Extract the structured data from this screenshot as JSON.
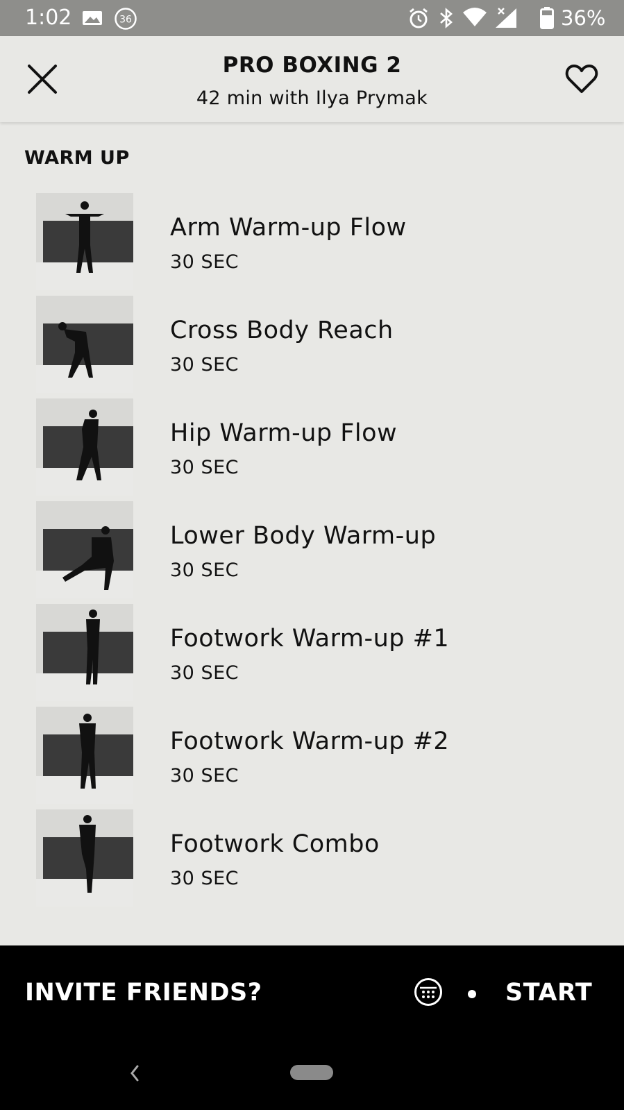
{
  "status_bar": {
    "time": "1:02",
    "notification_badge": "36",
    "battery": "36%",
    "icons": [
      "image-icon",
      "notification-count-icon",
      "alarm-icon",
      "bluetooth-icon",
      "wifi-icon",
      "signal-icon",
      "battery-icon"
    ]
  },
  "header": {
    "title": "PRO BOXING 2",
    "subtitle": "42 min with Ilya Prymak",
    "close_icon": "close-icon",
    "favorite_icon": "heart-icon"
  },
  "section": {
    "title": "WARM UP",
    "exercises": [
      {
        "name": "Arm Warm-up Flow",
        "duration": "30 SEC"
      },
      {
        "name": "Cross Body Reach",
        "duration": "30 SEC"
      },
      {
        "name": "Hip Warm-up Flow",
        "duration": "30 SEC"
      },
      {
        "name": "Lower Body Warm-up",
        "duration": "30 SEC"
      },
      {
        "name": "Footwork Warm-up #1",
        "duration": "30 SEC"
      },
      {
        "name": "Footwork Warm-up #2",
        "duration": "30 SEC"
      },
      {
        "name": "Footwork Combo",
        "duration": "30 SEC"
      }
    ]
  },
  "bottom_bar": {
    "invite_label": "INVITE FRIENDS?",
    "calendar_icon": "calendar-icon",
    "start_label": "START"
  },
  "colors": {
    "background": "#e8e8e5",
    "status_bar": "#8e8e8b",
    "bottom_bar": "#000000",
    "text": "#111111"
  }
}
